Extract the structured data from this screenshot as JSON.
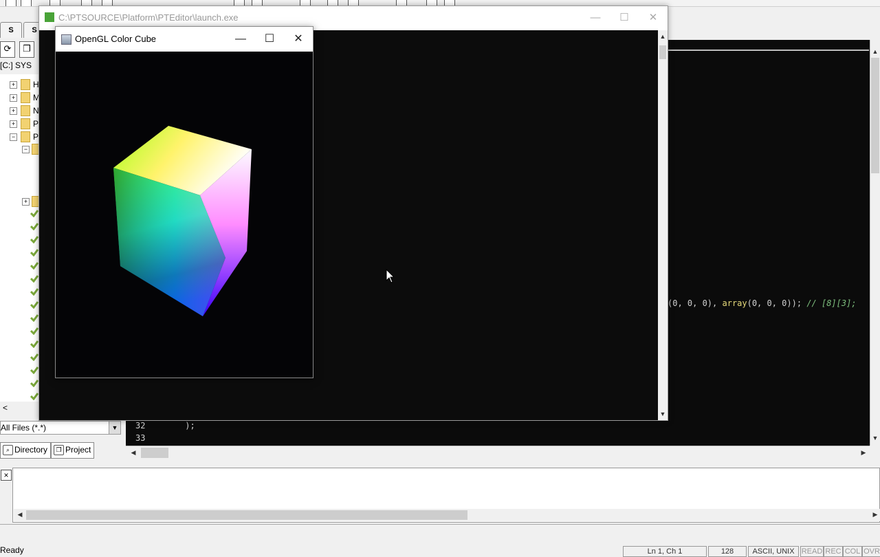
{
  "editor": {
    "side_tabs": [
      "S",
      "S"
    ],
    "drive_label": "[C:] SYS",
    "tree": {
      "folders": [
        {
          "label": "H",
          "expander": "+"
        },
        {
          "label": "M",
          "expander": "+"
        },
        {
          "label": "N",
          "expander": "+"
        },
        {
          "label": "P",
          "expander": "+"
        },
        {
          "label": "P",
          "expander": "−"
        }
      ]
    },
    "scroll_left_arrow": "<",
    "file_filter": "All Files (*.*)",
    "bottom_tabs": {
      "directory": "Directory",
      "project": "Project"
    },
    "code": {
      "visible_fragment": {
        "part1": "(0, 0, 0), ",
        "part2": "array",
        "part3": "(0, 0, 0)); ",
        "comment": "// [8][3];"
      },
      "lines": [
        {
          "number": "32",
          "text": "        );"
        },
        {
          "number": "33",
          "text": ""
        }
      ]
    },
    "output_close": "×",
    "status": {
      "ready": "Ready",
      "position": "Ln 1, Ch 1",
      "count": "128",
      "encoding": "ASCII, UNIX",
      "read": "READ",
      "rec": "REC",
      "col": "COL",
      "ovr": "OVR"
    }
  },
  "console_window": {
    "title": "C:\\PTSOURCE\\Platform\\PTEditor\\launch.exe",
    "minimize": "—",
    "maximize": "☐",
    "close": "✕"
  },
  "gl_window": {
    "title": "OpenGL Color Cube",
    "minimize": "—",
    "maximize": "☐",
    "close": "✕"
  },
  "colors": {
    "console_bg": "#0c0c0c",
    "gl_bg": "#040406",
    "code_bg": "#0b0b0b",
    "keyword_yellow": "#e6d97b",
    "comment_green": "#7ec07e",
    "console_icon_green": "#49a338",
    "folder_yellow": "#f2d271"
  }
}
